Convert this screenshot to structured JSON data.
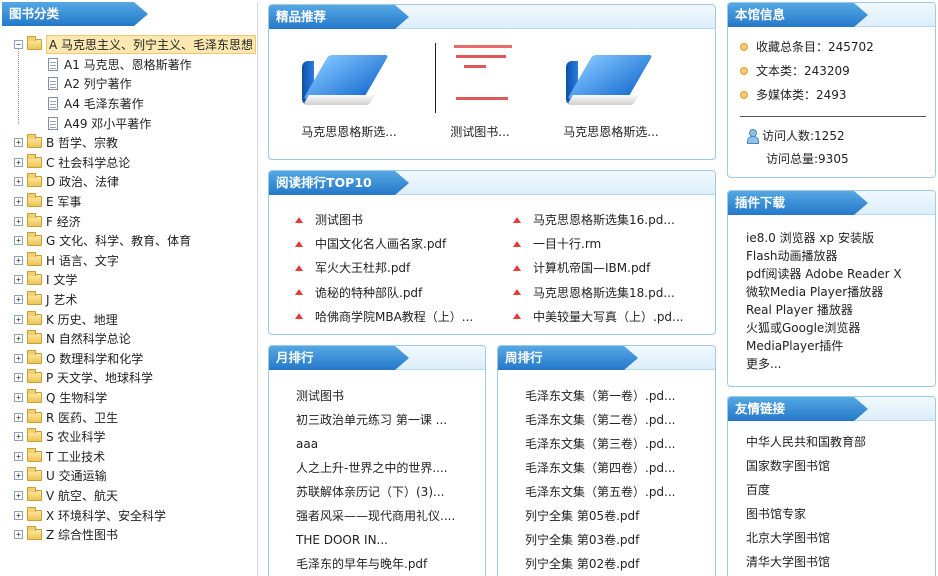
{
  "tree": {
    "title": "图书分类",
    "root": {
      "label": "A 马克思主义、列宁主义、毛泽东思想"
    },
    "children": [
      "A1 马克思、恩格斯著作",
      "A2 列宁著作",
      "A4 毛泽东著作",
      "A49 邓小平著作"
    ],
    "categories": [
      "B 哲学、宗教",
      "C 社会科学总论",
      "D 政治、法律",
      "E 军事",
      "F 经济",
      "G 文化、科学、教育、体育",
      "H 语言、文字",
      "I 文学",
      "J 艺术",
      "K 历史、地理",
      "N 自然科学总论",
      "O 数理科学和化学",
      "P 天文学、地球科学",
      "Q 生物科学",
      "R 医药、卫生",
      "S 农业科学",
      "T 工业技术",
      "U 交通运输",
      "V 航空、航天",
      "X 环境科学、安全科学",
      "Z 综合性图书"
    ]
  },
  "featured": {
    "title": "精品推荐",
    "items": [
      "马克思恩格斯选...",
      "测试图书...",
      "马克思恩格斯选..."
    ]
  },
  "rank": {
    "title": "阅读排行TOP10",
    "left": [
      "测试图书",
      "中国文化名人画名家.pdf",
      "军火大王杜邦.pdf",
      "诡秘的特种部队.pdf",
      "哈佛商学院MBA教程（上）..."
    ],
    "right": [
      "马克思恩格斯选集16.pd...",
      "一目十行.rm",
      "计算机帝国—IBM.pdf",
      "马克思恩格斯选集18.pd...",
      "中美较量大写真（上）.pd..."
    ]
  },
  "month": {
    "title": "月排行",
    "items": [
      "测试图书",
      "初三政治单元练习 第一课 ...",
      "aaa",
      "人之上升-世界之中的世界....",
      "苏联解体亲历记（下）(3)...",
      "强者风采——现代商用礼仪....",
      "THE DOOR IN...",
      "毛泽东的早年与晚年.pdf"
    ]
  },
  "week": {
    "title": "周排行",
    "items": [
      "毛泽东文集（第一卷）.pd...",
      "毛泽东文集（第二卷）.pd...",
      "毛泽东文集（第三卷）.pd...",
      "毛泽东文集（第四卷）.pd...",
      "毛泽东文集（第五卷）.pd...",
      "列宁全集 第05卷.pdf",
      "列宁全集 第03卷.pdf",
      "列宁全集 第02卷.pdf"
    ]
  },
  "info": {
    "title": "本馆信息",
    "total": "收藏总条目：245702",
    "text": "文本类：243209",
    "media": "多媒体类：2493",
    "visitors": "访问人数:1252",
    "visits": "访问总量:9305"
  },
  "plugins": {
    "title": "插件下载",
    "items": [
      "ie8.0 浏览器 xp 安装版",
      "Flash动画播放器",
      "pdf阅读器 Adobe Reader X",
      "微软Media Player播放器",
      "Real Player 播放器",
      "火狐或Google浏览器MediaPlayer插件",
      "更多..."
    ]
  },
  "links": {
    "title": "友情链接",
    "items": [
      "中华人民共和国教育部",
      "国家数字图书馆",
      "百度",
      "图书馆专家",
      "北京大学图书馆",
      "清华大学图书馆"
    ]
  },
  "colors": {
    "accent": "#2478c9",
    "border": "#9ccbe8",
    "rank_marker": "#e03a3a"
  }
}
